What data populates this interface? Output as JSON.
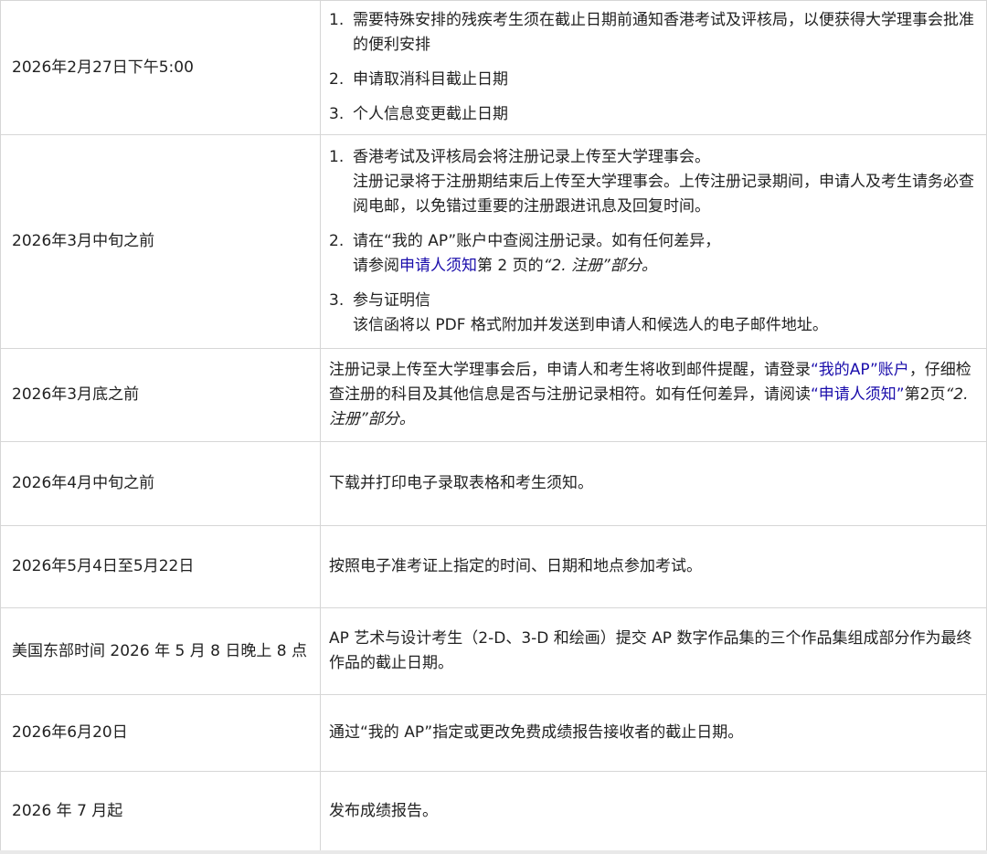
{
  "rows": [
    {
      "date": "2026年2月27日下午5:00",
      "items": [
        {
          "num": "1.",
          "text": "需要特殊安排的残疾考生须在截止日期前通知香港考试及评核局，以便获得大学理事会批准的便利安排"
        },
        {
          "num": "2.",
          "text": "申请取消科目截止日期"
        },
        {
          "num": "3.",
          "text": "个人信息变更截止日期"
        }
      ]
    },
    {
      "date": "2026年3月中旬之前",
      "items": [
        {
          "num": "1.",
          "text": "香港考试及评核局会将注册记录上传至大学理事会。",
          "sub": "注册记录将于注册期结束后上传至大学理事会。上传注册记录期间，申请人及考生请务必查阅电邮，以免错过重要的注册跟进讯息及回复时间。"
        },
        {
          "num": "2.",
          "text": "请在“我的 AP”账户中查阅注册记录。如有任何差异，",
          "sub_pre": "请参阅",
          "sub_link": "申请人须知",
          "sub_post": "第 2 页的",
          "sub_em": "“2. 注册”部分。"
        },
        {
          "num": "3.",
          "text": "参与证明信",
          "sub": "该信函将以 PDF 格式附加并发送到申请人和候选人的电子邮件地址。"
        }
      ]
    },
    {
      "date": "2026年3月底之前",
      "text_pre": "注册记录上传至大学理事会后，申请人和考生将收到邮件提醒，请登录",
      "link1": "“我的AP”账户",
      "text_mid": "，仔细检查注册的科目及其他信息是否与注册记录相符。如有任何差异，请阅读",
      "link2": "“申请人须知”",
      "text_post": "第2页",
      "em": "“2. 注册”部分。"
    },
    {
      "date": "2026年4月中旬之前",
      "text": "下载并打印电子录取表格和考生须知。"
    },
    {
      "date": "2026年5月4日至5月22日",
      "text": "按照电子准考证上指定的时间、日期和地点参加考试。"
    },
    {
      "date": "美国东部时间 2026 年 5 月 8 日晚上 8 点",
      "text": "AP 艺术与设计考生（2-D、3-D 和绘画）提交 AP 数字作品集的三个作品集组成部分作为最终作品的截止日期。"
    },
    {
      "date": "2026年6月20日",
      "text": "通过“我的 AP”指定或更改免费成绩报告接收者的截止日期。"
    },
    {
      "date": "2026 年 7 月起",
      "text": "发布成绩报告。"
    }
  ],
  "colors": {
    "link": "#1a0dab",
    "border": "#d6d6d6",
    "text": "#222222"
  }
}
